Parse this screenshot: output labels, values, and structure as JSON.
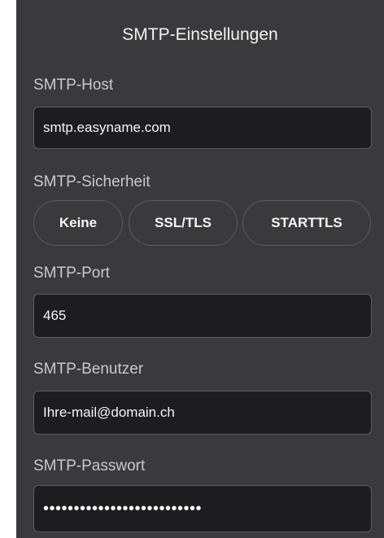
{
  "title": "SMTP-Einstellungen",
  "host": {
    "label": "SMTP-Host",
    "value": "smtp.easyname.com"
  },
  "security": {
    "label": "SMTP-Sicherheit",
    "options": [
      "Keine",
      "SSL/TLS",
      "STARTTLS"
    ]
  },
  "port": {
    "label": "SMTP-Port",
    "value": "465"
  },
  "user": {
    "label": "SMTP-Benutzer",
    "value": "Ihre-mail@domain.ch"
  },
  "password": {
    "label": "SMTP-Passwort",
    "masked_value": "••••••••••••••••••••••••••"
  },
  "colors": {
    "panel_bg": "#3a3a3c",
    "field_bg": "#1d1d1f",
    "border": "#5c5c60",
    "label_text": "#c9c9cc",
    "value_text": "#f5f5f7"
  }
}
